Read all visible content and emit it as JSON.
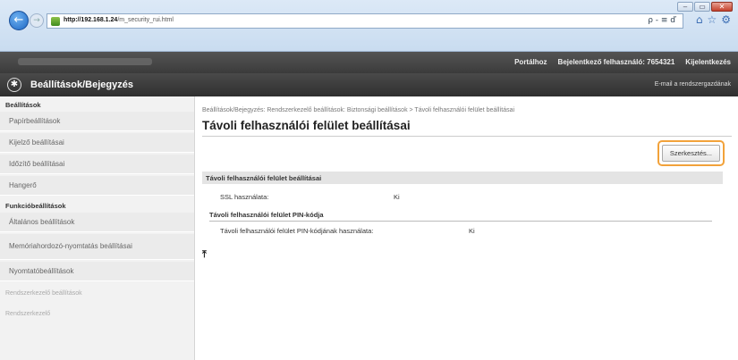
{
  "browser": {
    "url_host": "http://192.168.1.24",
    "url_path": "/m_security_rui.html",
    "address_tools": "ρ - ≡ ď",
    "window_buttons": [
      "–",
      "▭",
      "✕"
    ]
  },
  "topbar": {
    "portal": "Portálhoz",
    "logged_in_label": "Bejelentkező felhasználó:",
    "user": "7654321",
    "logout": "Kijelentkezés"
  },
  "subbar": {
    "title": "Beállítások/Bejegyzés",
    "mail": "E-mail a rendszergazdának"
  },
  "sidebar": {
    "section1": "Beállítások",
    "items1": [
      "Papírbeállítások",
      "Kijelző beállításai",
      "Időzítő beállításai",
      "Hangerő"
    ],
    "section2": "Funkcióbeállítások",
    "items2": [
      "Általános beállítások",
      "Memóriahordozó-nyomtatás beállításai",
      "Nyomtatóbeállítások"
    ],
    "section3": "Rendszerkezelő beállítások",
    "item3": "Rendszerkezelő"
  },
  "main": {
    "breadcrumb": "Beállítások/Bejegyzés: Rendszerkezelő beállítások: Biztonsági beállítások > Távoli felhasználói felület beállításai",
    "title": "Távoli felhasználói felület beállításai",
    "edit_button": "Szerkesztés...",
    "section_title": "Távoli felhasználói felület beállításai",
    "ssl_label": "SSL használata:",
    "ssl_value": "Ki",
    "pin_section": "Távoli felhasználói felület PIN-kódja",
    "pin_label": "Távoli felhasználói felület PIN-kódjának használata:",
    "pin_value": "Ki",
    "top_icon": "⤒"
  }
}
